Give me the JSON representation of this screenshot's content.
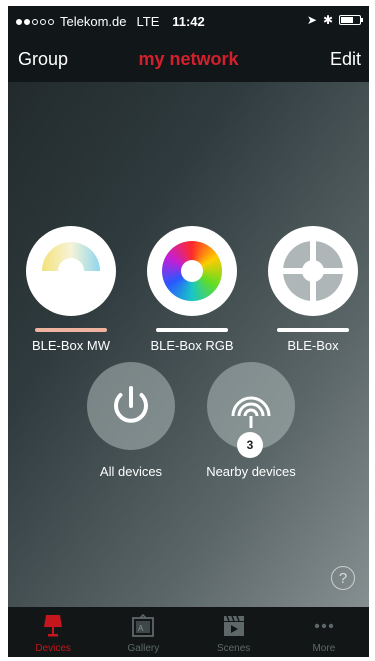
{
  "status_bar": {
    "carrier": "Telekom.de",
    "network": "LTE",
    "time": "11:42"
  },
  "nav": {
    "left": "Group",
    "title": "my network",
    "right": "Edit"
  },
  "devices": [
    {
      "label": "BLE-Box MW",
      "bar_color": "#f0b3a0"
    },
    {
      "label": "BLE-Box RGB",
      "bar_color": "#ffffff"
    },
    {
      "label": "BLE-Box",
      "bar_color": "#ffffff"
    }
  ],
  "actions": {
    "all_devices": {
      "label": "All devices",
      "icon": "power-icon"
    },
    "nearby_devices": {
      "label": "Nearby devices",
      "icon": "signal-icon",
      "count": "3"
    }
  },
  "help": {
    "label": "?"
  },
  "tabs": [
    {
      "label": "Devices",
      "icon": "lamp-icon",
      "active": true
    },
    {
      "label": "Gallery",
      "icon": "gallery-icon",
      "active": false
    },
    {
      "label": "Scenes",
      "icon": "clapperboard-icon",
      "active": false
    },
    {
      "label": "More",
      "icon": "more-icon",
      "active": false
    }
  ],
  "colors": {
    "accent": "#d4202c",
    "tab_inactive": "#5f6869"
  }
}
